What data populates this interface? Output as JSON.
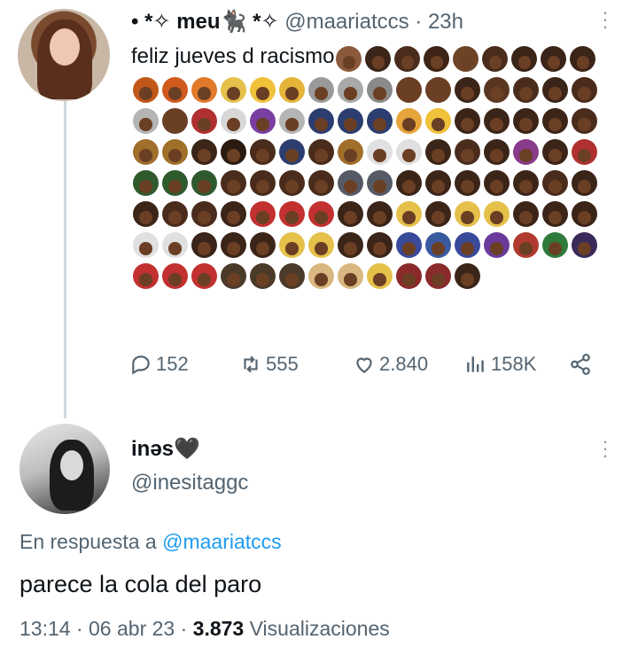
{
  "tweet1": {
    "display_name": "• *✧ meu🐈‍⬛ *✧",
    "handle": "@maariatccs",
    "time": "23h",
    "text": "feliz jueves d racismo",
    "emoji_colors": [
      "#8b5a3c",
      "#3b2418",
      "#4a2c1c",
      "#3d2416",
      "#6e4426",
      "#4a2c1c",
      "#3b2418",
      "#3b2418",
      "#3b2418",
      "#c2571a",
      "#d05a1e",
      "#e07a2a",
      "#e5c04a",
      "#f0c23a",
      "#e5b53a",
      "#9a9a9a",
      "#a8a8a8",
      "#8a8a8a",
      "#6b3f24",
      "#6b3f24",
      "#3b2418",
      "#5a3622",
      "#4a2c1c",
      "#3b2418",
      "#4a2c1c",
      "#b5b5b5",
      "#6b3f24",
      "#b03030",
      "#d8d8d8",
      "#7a3fa0",
      "#b5b5b5",
      "#2c3e70",
      "#2c3e70",
      "#2c3e70",
      "#e5a53a",
      "#f0c23a",
      "#3b2418",
      "#3b2418",
      "#3b2418",
      "#3b2418",
      "#4a2c1c",
      "#a0702a",
      "#a0702a",
      "#3b2418",
      "#2a1a10",
      "#4a2c1c",
      "#2c3e70",
      "#4a2c1c",
      "#a0702a",
      "#e0e0e0",
      "#e0e0e0",
      "#3b2418",
      "#4a2c1c",
      "#3b2418",
      "#8a3a8a",
      "#3b2418",
      "#b03030",
      "#2e5a2e",
      "#2e5a2e",
      "#2e5a2e",
      "#4a2c1c",
      "#4a2c1c",
      "#4a2c1c",
      "#4a2c1c",
      "#555a66",
      "#555a66",
      "#3b2418",
      "#3b2418",
      "#3b2418",
      "#3b2418",
      "#3b2418",
      "#4a2c1c",
      "#3b2418",
      "#3b2418",
      "#4a2c1c",
      "#4a2c1c",
      "#3b2418",
      "#c23030",
      "#c23030",
      "#c23030",
      "#3b2418",
      "#3b2418",
      "#e5c04a",
      "#3b2418",
      "#e5c04a",
      "#e5c04a",
      "#3b2418",
      "#3b2418",
      "#3b2418",
      "#e0e0e0",
      "#e0e0e0",
      "#3b2418",
      "#3b2418",
      "#3b2418",
      "#e5c04a",
      "#e5c04a",
      "#3b2418",
      "#3b2418",
      "#3a4a9a",
      "#3a5aa0",
      "#3a4a9a",
      "#6a3a9a",
      "#b03a30",
      "#2e7a3a",
      "#3a2a5a",
      "#c23030",
      "#c23030",
      "#c23030",
      "#4a3a2a",
      "#4a3a2a",
      "#4a3a2a",
      "#d8b880",
      "#d8b880",
      "#e5c04a",
      "#8a2a2a",
      "#8a2a2a",
      "#3b2418"
    ],
    "stats": {
      "replies": "152",
      "retweets": "555",
      "likes": "2.840",
      "views": "158K"
    }
  },
  "tweet2": {
    "display_name": "inəs🖤",
    "handle": "@inesitaggc",
    "reply_prefix": "En respuesta a",
    "reply_handle": "@maariatccs",
    "text": "parece la cola del paro",
    "time": "13:14",
    "date": "06 abr 23",
    "views_count": "3.873",
    "views_label": "Visualizaciones"
  },
  "colors": {
    "link": "#1d9bf0",
    "secondary": "#536471",
    "thread_line": "#cfd9de"
  }
}
